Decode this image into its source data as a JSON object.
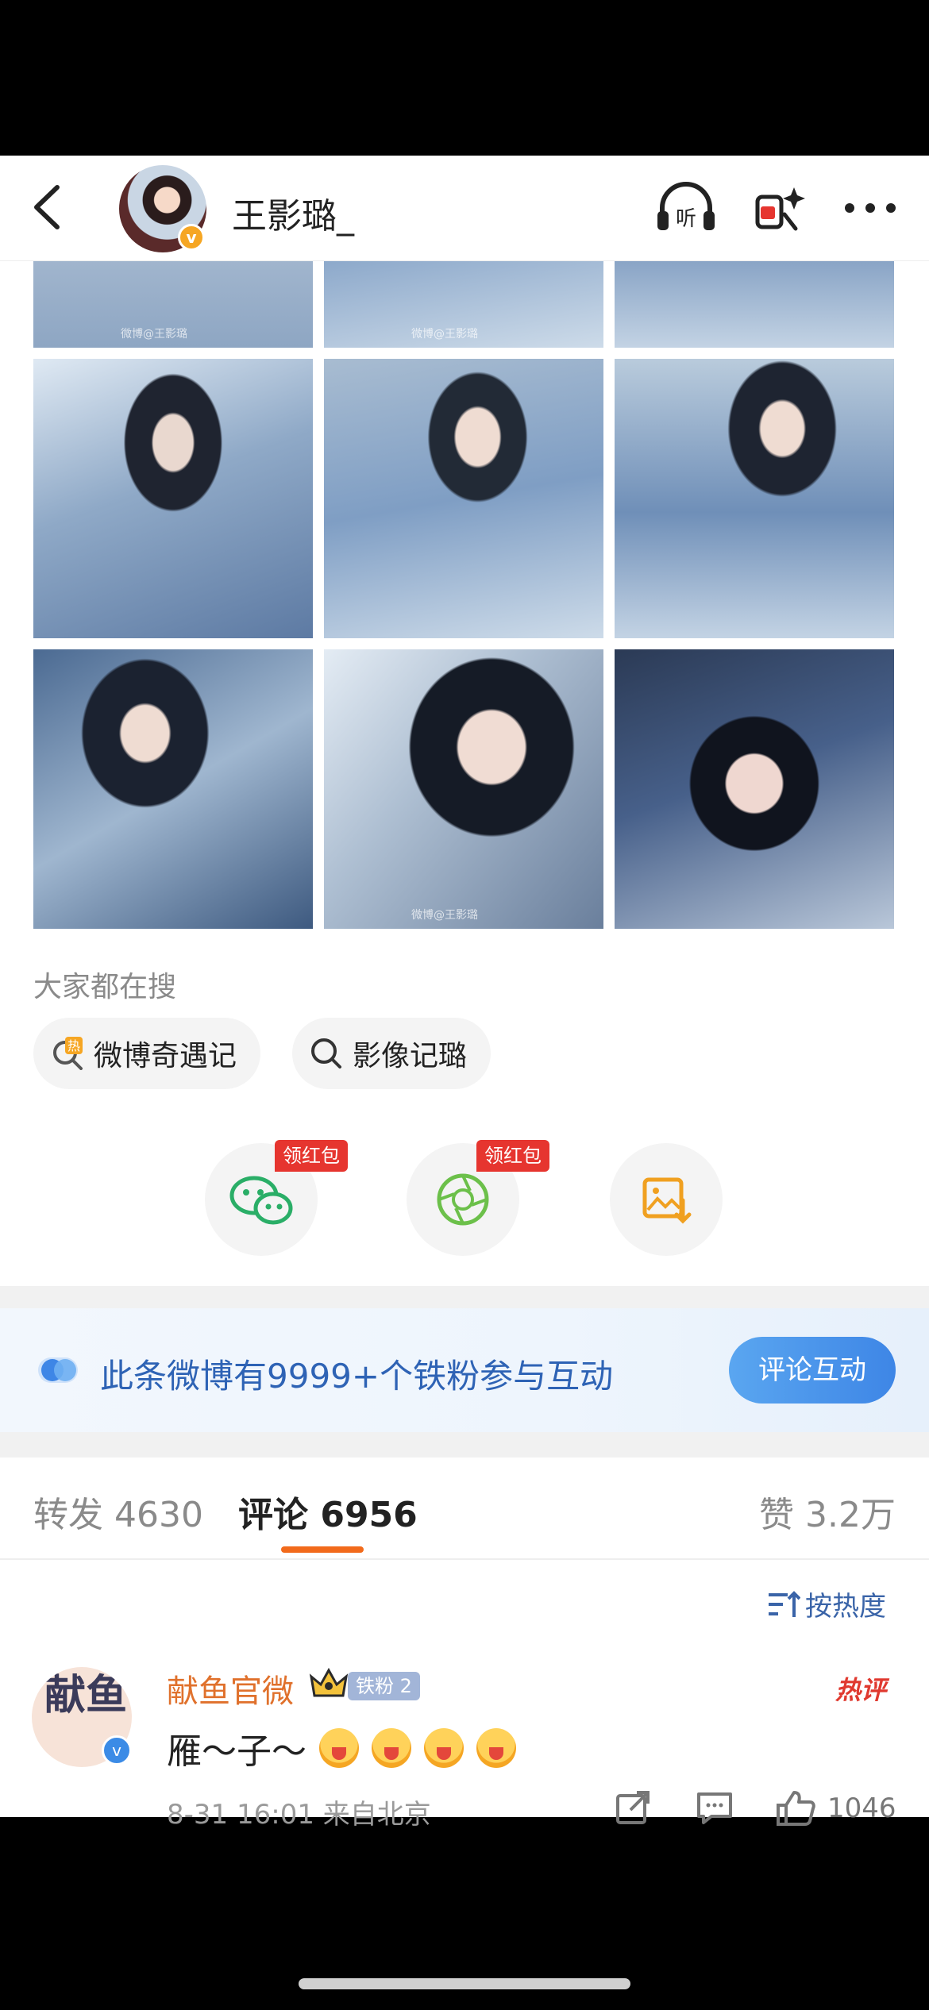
{
  "header": {
    "title": "王影璐_",
    "listen_icon": "headphones-listen-icon",
    "rings_icon": "red-packet-search-icon",
    "more_icon": "more-dots-icon"
  },
  "photos": {
    "watermark": "微博@王影璐"
  },
  "search_section": {
    "title": "大家都在搜",
    "chips": [
      {
        "label": "微博奇遇记",
        "icon": "hot-search-icon"
      },
      {
        "label": "影像记璐",
        "icon": "search-icon"
      }
    ]
  },
  "share": {
    "red_tag": "领红包",
    "items": [
      "wechat-icon",
      "moments-icon",
      "save-image-icon"
    ]
  },
  "banner": {
    "text": "此条微博有9999+个铁粉参与互动",
    "button": "评论互动"
  },
  "tabs": {
    "repost_label": "转发",
    "repost_count": "4630",
    "comment_label": "评论",
    "comment_count": "6956",
    "like_label": "赞",
    "like_count": "3.2万"
  },
  "sort": {
    "label": "按热度"
  },
  "comment": {
    "avatar_text": "献鱼",
    "name": "献鱼官微",
    "fan_badge": "铁粉 2",
    "hot_tag": "热评",
    "text": "雁～子～",
    "meta": "8-31 16:01  来自北京",
    "likes": "1046"
  },
  "colors": {
    "accent_orange": "#f26a1b",
    "link_blue": "#3a64a8",
    "red_tag": "#e6352f"
  }
}
